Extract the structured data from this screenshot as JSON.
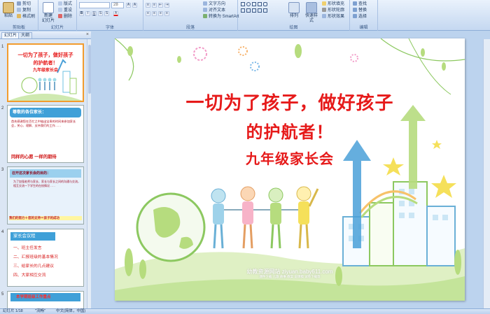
{
  "ribbon": {
    "groups": {
      "clipboard": "剪贴板",
      "slides": "幻灯片",
      "font": "字体",
      "paragraph": "段落",
      "drawing": "绘图",
      "editing": "编辑"
    },
    "paste": "粘贴",
    "cut": "剪切",
    "copy": "复制",
    "format_painter": "格式刷",
    "new_slide": "新建",
    "new_slide2": "幻灯片",
    "layout": "版式",
    "reset": "重设",
    "delete": "删除",
    "font_size": "28",
    "text_direction": "文字方向",
    "align_text": "对齐文本",
    "convert_smartart": "转换为 SmartArt",
    "arrange": "排列",
    "quick_styles": "快速样式",
    "shape_fill": "形状填充",
    "shape_outline": "形状轮廓",
    "shape_effects": "形状效果",
    "find": "查找",
    "replace": "替换",
    "select": "选择"
  },
  "pane": {
    "tab_slides": "幻灯片",
    "tab_outline": "大纲",
    "close": "×"
  },
  "thumbnails": [
    {
      "num": "1",
      "line1": "一切为了孩子，做好孩子",
      "line2": "的护航者！",
      "line3": "九年级家长会"
    },
    {
      "num": "2",
      "header": "尊敬的各位家长：",
      "body": "首先感谢您在百忙之中抽出宝贵的时间来参加家长会，关心、理解、支持我们的工作……",
      "footer": "同样的心愿 一样的期待"
    },
    {
      "num": "3",
      "header": "召开这次家长会的目的：",
      "body": "为了加强老师与家长、家长与家长之间的沟通与交流，相互交流一下学生的在校情况……",
      "footer": "我们的努力＋您的支持＝孩子的成功"
    },
    {
      "num": "4",
      "header": "家长会议程",
      "items": [
        "一、班主任发言",
        "二、汇报班级的基本情况",
        "三、给家长的几点建议",
        "四、大家相互交流"
      ]
    },
    {
      "num": "5",
      "header": "本学期班级工作重点"
    }
  ],
  "slide": {
    "title_line1": "一切为了孩子，做好孩子",
    "title_line2": "的护航者！",
    "subtitle": "九年级家长会",
    "watermark": "幼教资源网站  ziyuan.baby611.com",
    "watermark_small": "课件下载  儿歌  故事  教案  说课稿  试卷下载等"
  },
  "status": {
    "slide_pos": "幻灯片 1/18",
    "theme": "\"流畅\"",
    "lang": "中文(简体，中国)"
  },
  "colors": {
    "title_red": "#e61a1a",
    "ribbon_bg": "#d3e2f5",
    "canvas_bg": "#bcd3ee",
    "selected_border": "#f29c2e"
  }
}
